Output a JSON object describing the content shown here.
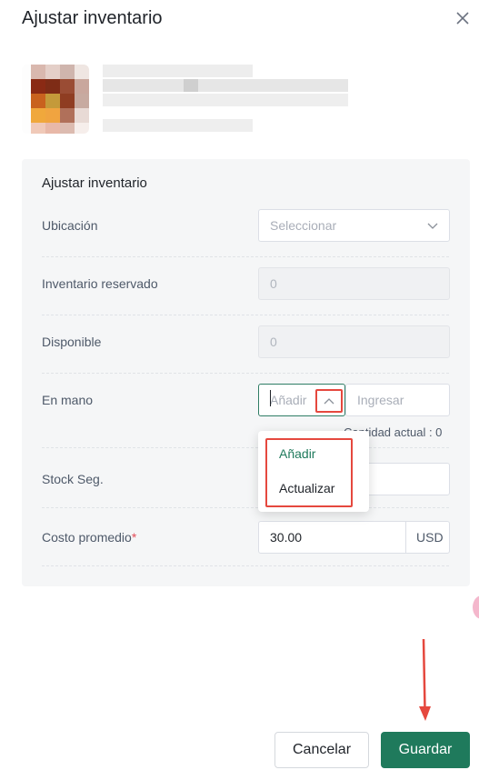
{
  "dialog": {
    "title": "Ajustar inventario",
    "close_icon": "close-icon"
  },
  "section": {
    "title": "Ajustar inventario"
  },
  "fields": {
    "location": {
      "label": "Ubicación",
      "placeholder": "Seleccionar",
      "icon": "chevron-down-icon"
    },
    "reserved": {
      "label": "Inventario reservado",
      "value": "0"
    },
    "available": {
      "label": "Disponible",
      "value": "0"
    },
    "on_hand": {
      "label": "En mano",
      "mode_placeholder": "Añadir",
      "toggle_icon": "chevron-up-icon",
      "qty_placeholder": "Ingresar",
      "hint": "Cantidad actual : 0",
      "options": [
        "Añadir",
        "Actualizar"
      ],
      "selected_option": "Añadir"
    },
    "safety_stock": {
      "label": "Stock Seg."
    },
    "avg_cost": {
      "label": "Costo promedio",
      "required_mark": "*",
      "value": "30.00",
      "currency": "USD"
    }
  },
  "footer": {
    "cancel_label": "Cancelar",
    "save_label": "Guardar"
  },
  "colors": {
    "primary": "#1f7a5c",
    "highlight": "#e5483e",
    "required": "#e34d59"
  }
}
